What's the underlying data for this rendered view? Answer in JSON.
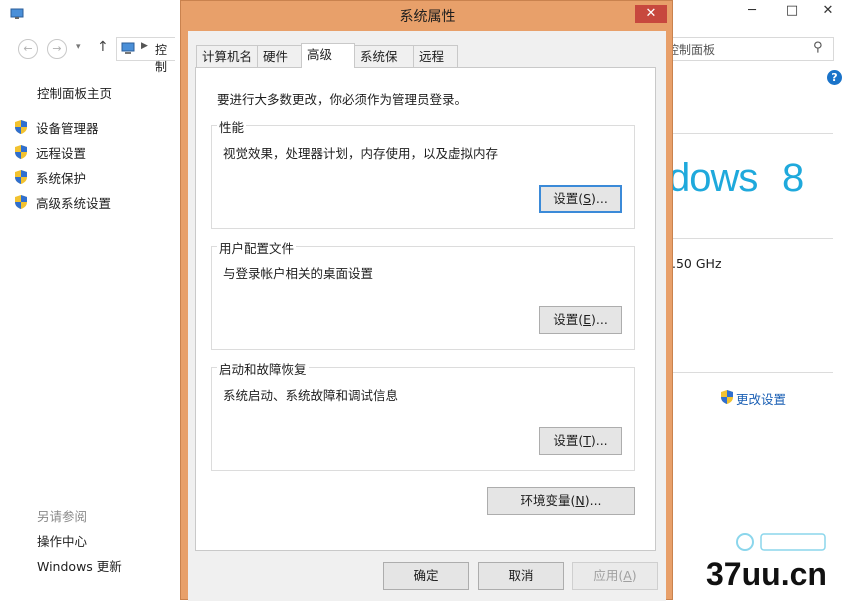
{
  "background_window": {
    "address_text": "控制",
    "search_placeholder": "控制面板",
    "sidebar": {
      "home_link": "控制面板主页",
      "items": [
        {
          "label": "设备管理器"
        },
        {
          "label": "远程设置"
        },
        {
          "label": "系统保护"
        },
        {
          "label": "高级系统设置"
        }
      ],
      "see_also_label": "另请参阅",
      "see_also_links": [
        "操作中心",
        "Windows 更新"
      ]
    },
    "windows_logo_text": "dows",
    "windows_logo_number": "8",
    "processor_speed": ".50 GHz",
    "change_settings_link": "更改设置",
    "watermark": "37uu.cn",
    "watermark_accent": "#00a6d6"
  },
  "dialog": {
    "title": "系统属性",
    "close_glyph": "✕",
    "tabs": [
      {
        "label": "计算机名",
        "active": false
      },
      {
        "label": "硬件",
        "active": false
      },
      {
        "label": "高级",
        "active": true
      },
      {
        "label": "系统保护",
        "active": false
      },
      {
        "label": "远程",
        "active": false
      }
    ],
    "admin_notice": "要进行大多数更改，你必须作为管理员登录。",
    "groups": {
      "performance": {
        "title": "性能",
        "description": "视觉效果，处理器计划，内存使用，以及虚拟内存",
        "button_pre": "设置(",
        "button_key": "S",
        "button_post": ")..."
      },
      "user_profiles": {
        "title": "用户配置文件",
        "description": "与登录帐户相关的桌面设置",
        "button_pre": "设置(",
        "button_key": "E",
        "button_post": ")..."
      },
      "startup_recovery": {
        "title": "启动和故障恢复",
        "description": "系统启动、系统故障和调试信息",
        "button_pre": "设置(",
        "button_key": "T",
        "button_post": ")..."
      }
    },
    "env_button_pre": "环境变量(",
    "env_button_key": "N",
    "env_button_post": ")...",
    "ok_label": "确定",
    "cancel_label": "取消",
    "apply_pre": "应用(",
    "apply_key": "A",
    "apply_post": ")"
  }
}
